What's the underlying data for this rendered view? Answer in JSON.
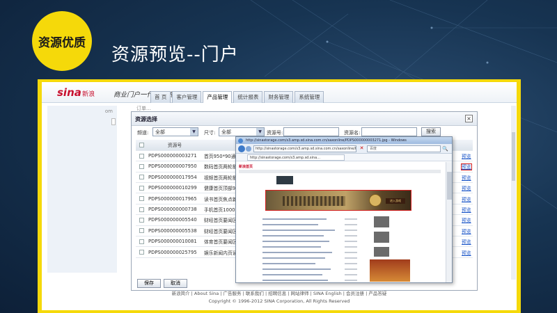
{
  "slide": {
    "badge": "资源优质",
    "title": "资源预览--门户"
  },
  "app": {
    "logo": "sina",
    "logo_sub": "新浪",
    "system_name": "商业门户一代理系统",
    "nav_tabs": [
      "首 页",
      "客户管理",
      "产品管理",
      "统计报表",
      "财务管理",
      "系统管理"
    ],
    "active_tab": "产品管理",
    "breadcrumb": "订单…",
    "sidebar_tag": "om"
  },
  "modal": {
    "title": "资源选择",
    "close_label": "×",
    "filters": {
      "channel_label": "频道:",
      "channel_value": "全部",
      "size_label": "尺寸:",
      "size_value": "全部",
      "res_no_label": "资源号:",
      "res_name_label": "资源名:",
      "search_label": "搜索"
    },
    "columns": [
      "",
      "资源号",
      ""
    ],
    "rows": [
      {
        "id": "PDPS000000003271",
        "name": "首页950*90通栏01"
      },
      {
        "id": "PDPS000000007950",
        "name": "数码首页两轮播950*"
      },
      {
        "id": "PDPS000000017954",
        "name": "视频首页两轮播950*"
      },
      {
        "id": "PDPS000000010299",
        "name": "健康首页顶部950*9"
      },
      {
        "id": "PDPS000000017965",
        "name": "读书首页焦点新闻右"
      },
      {
        "id": "PDPS000000000738",
        "name": "手机首页1000*90通"
      },
      {
        "id": "PDPS000000005540",
        "name": "财经首页要闻区左侧"
      },
      {
        "id": "PDPS000000005538",
        "name": "财经首页要闻区右侧"
      },
      {
        "id": "PDPS000000010081",
        "name": "体育首页要闻区右侧"
      },
      {
        "id": "PDPS000000025795",
        "name": "娱乐新闻内页读书内"
      }
    ],
    "preview_label": "预览",
    "save_label": "保存",
    "cancel_label": "取消"
  },
  "browser": {
    "title": "http://sinastorage.com/s3.amp.sd.sina.com.cn/saxonline/PDPS000000003271.jpg - Windows",
    "url": "http://sinastorage.com/s3.amp.sd.sina.com.cn/saxonline/PDPS000000003271.jpg",
    "tab_url": "http://sinastorage.com/s3.amp.sd.sina...",
    "search_placeholder": "百度",
    "close_glyph": "✕",
    "go_glyph": "🔍",
    "page_brand": "新浪首页",
    "ad_cta": "进入游戏"
  },
  "footer": {
    "links": "新浪简介 | About Sina | 广告服务 | 联系我们 | 招聘信息 | 网站律师 | SINA English | 会员注册 | 产品答疑",
    "copyright": "Copyright © 1996-2012 SINA Corporation, All Rights Reserved"
  },
  "colors": {
    "badge": "#f5d90a",
    "frame": "#f5d90a",
    "highlight": "#d41e1e",
    "link": "#1a55c8",
    "background": "#173452"
  },
  "icons": [
    "ie-icon",
    "back-icon",
    "forward-icon",
    "close-icon",
    "search-icon",
    "dropdown-arrow-icon"
  ]
}
